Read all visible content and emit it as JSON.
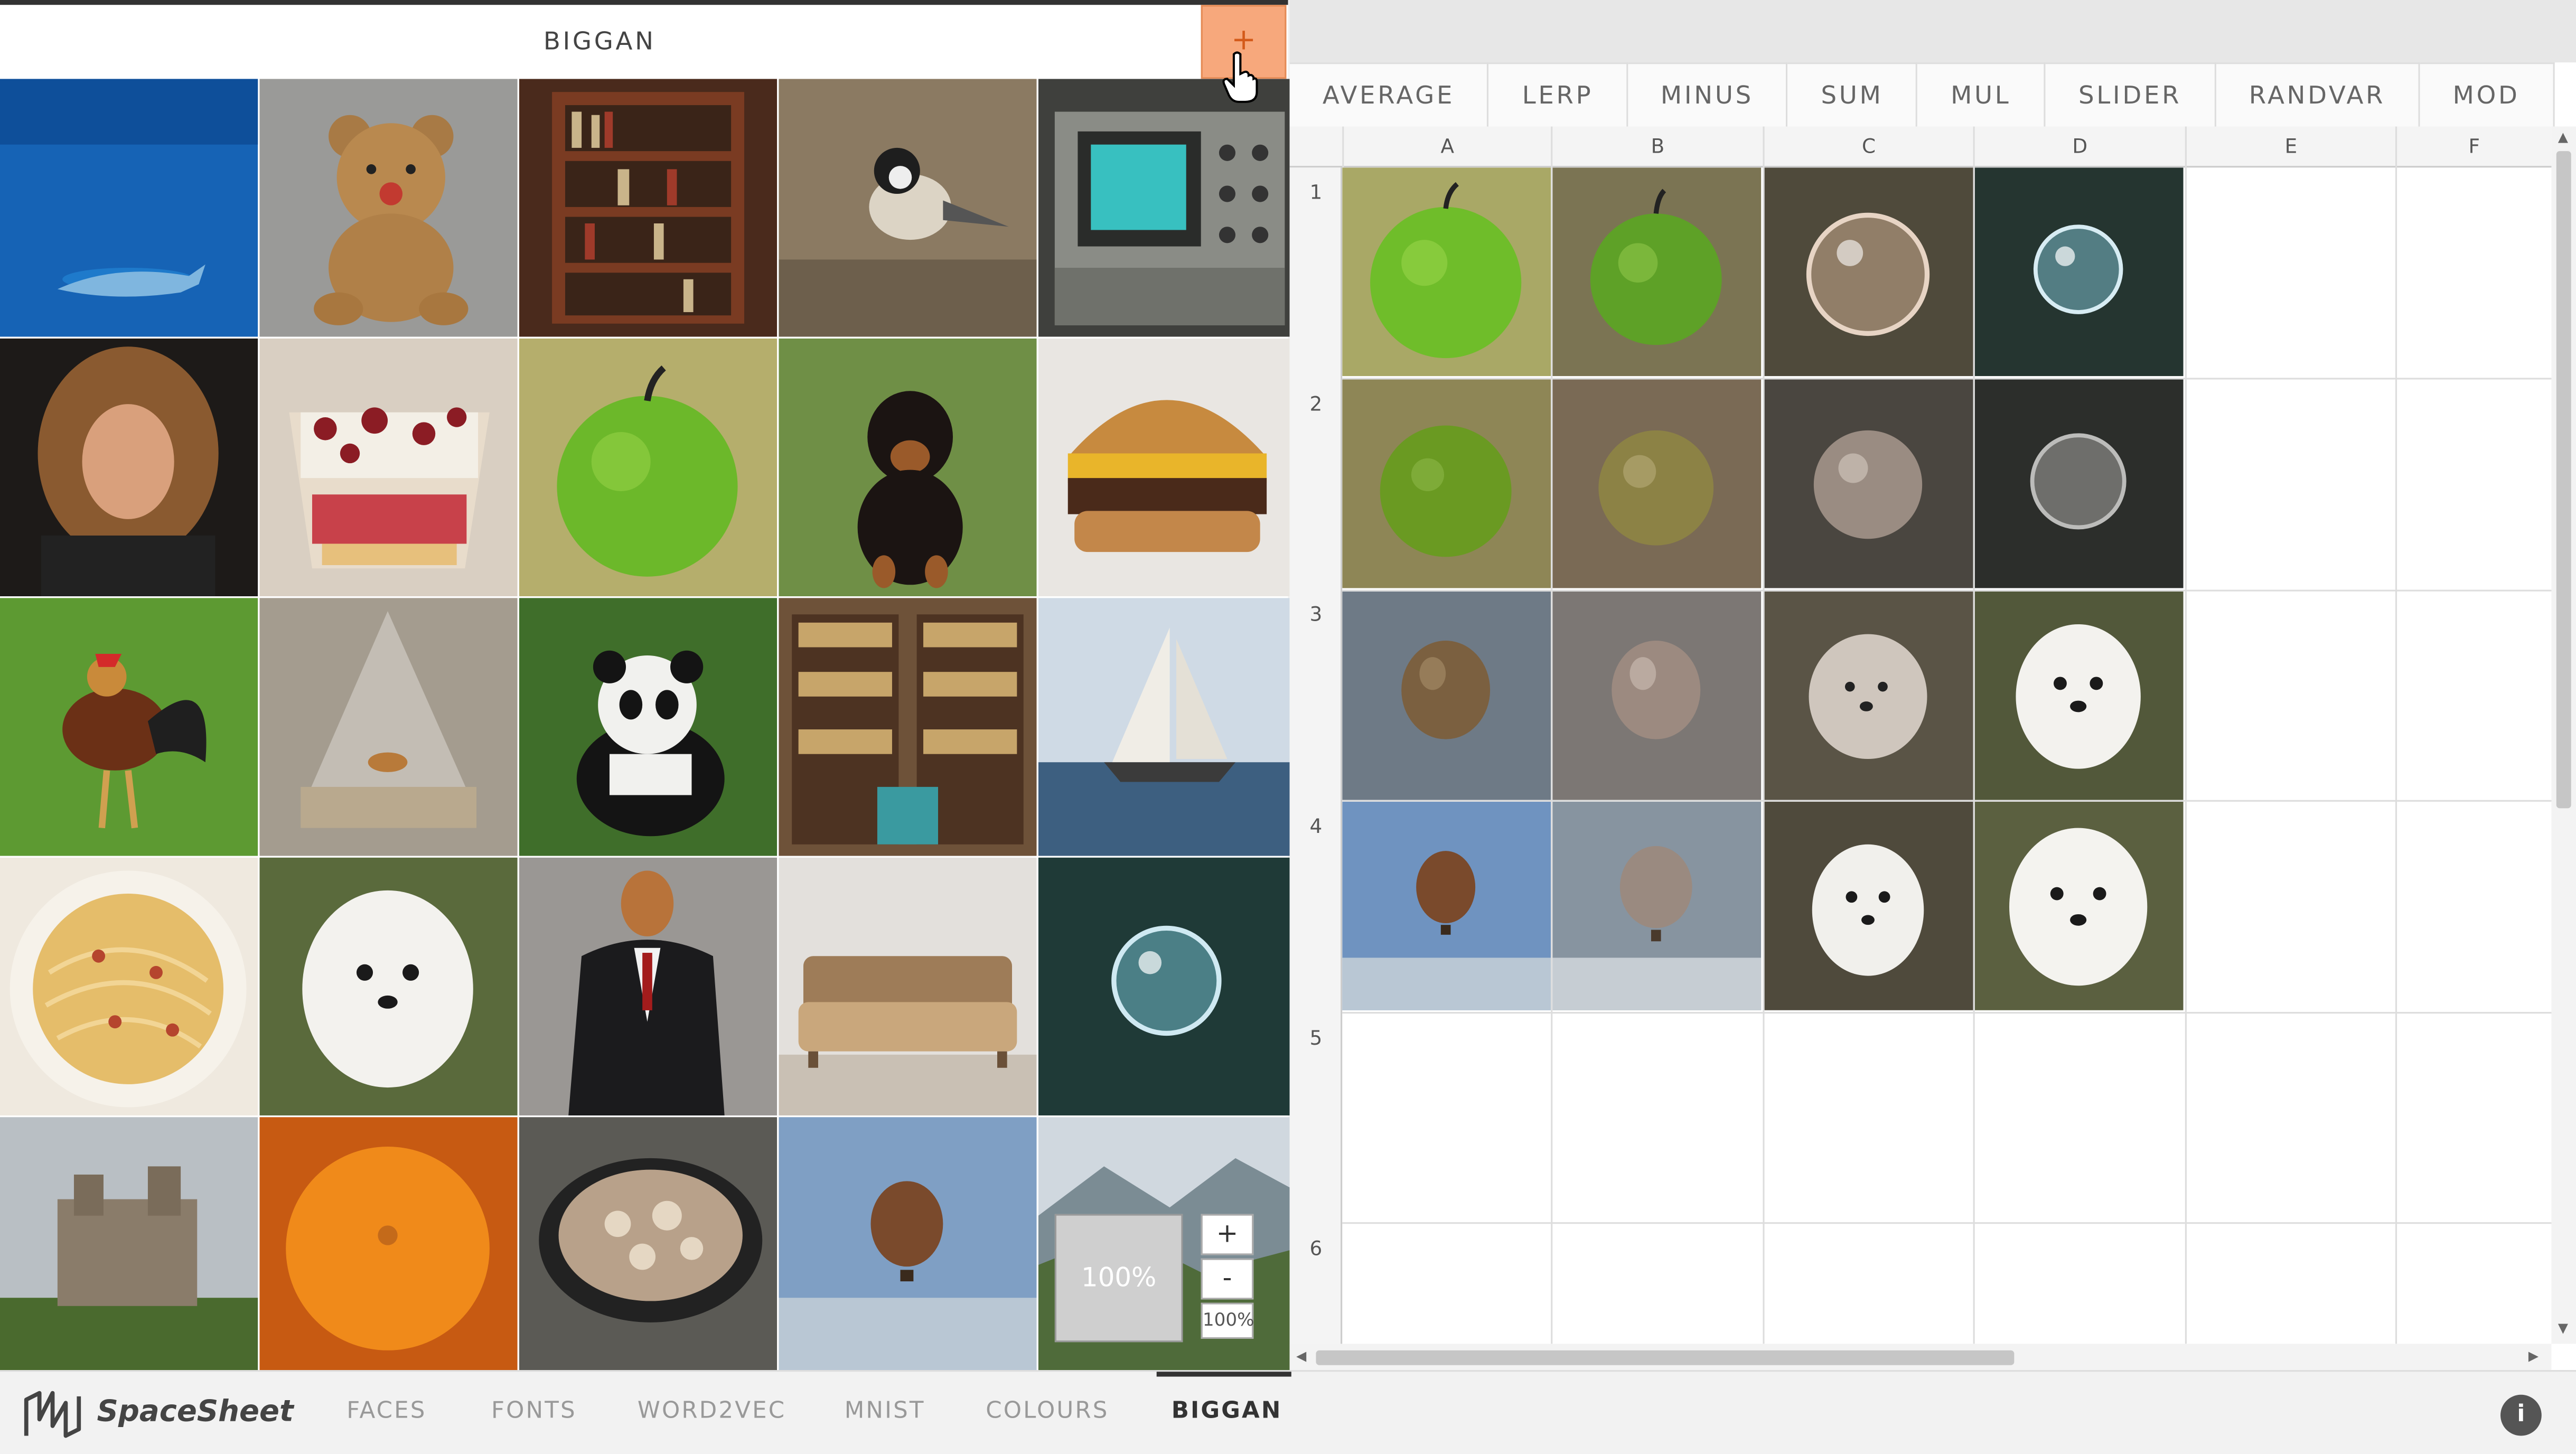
{
  "model_panel": {
    "title": "BIGGAN",
    "add_label": "+",
    "zoom": {
      "preview_label": "100%",
      "in_label": "+",
      "out_label": "-",
      "readout": "100%"
    }
  },
  "functions": [
    "AVERAGE",
    "LERP",
    "MINUS",
    "SUM",
    "MUL",
    "SLIDER",
    "RANDVAR",
    "MOD"
  ],
  "sheet": {
    "columns": [
      "A",
      "B",
      "C",
      "D",
      "E",
      "F"
    ],
    "rows": [
      "1",
      "2",
      "3",
      "4",
      "5",
      "6"
    ]
  },
  "gallery_icons": [
    "shark-image-icon",
    "teddy-bear-image-icon",
    "bookcase-image-icon",
    "chickadee-image-icon",
    "oscilloscope-image-icon",
    "wig-portrait-image-icon",
    "trifle-image-icon",
    "green-apple-image-icon",
    "rottweiler-image-icon",
    "cheeseburger-image-icon",
    "rooster-image-icon",
    "mosquito-net-image-icon",
    "panda-image-icon",
    "bookshop-image-icon",
    "sailboat-image-icon",
    "carbonara-image-icon",
    "maltese-dog-image-icon",
    "suit-man-image-icon",
    "sofa-image-icon",
    "bubble-image-icon",
    "castle-image-icon",
    "orange-image-icon",
    "stew-pot-image-icon",
    "hot-air-balloon-image-icon",
    "mountain-valley-image-icon"
  ],
  "bottom_bar": {
    "brand": "SpaceSheet",
    "tabs": [
      "FACES",
      "FONTS",
      "WORD2VEC",
      "MNIST",
      "COLOURS",
      "BIGGAN"
    ],
    "active_tab": "BIGGAN",
    "info_label": "i"
  },
  "colors": {
    "accent": "#f7a87c",
    "accent_border": "#e58a55",
    "text_dark": "#333333"
  }
}
